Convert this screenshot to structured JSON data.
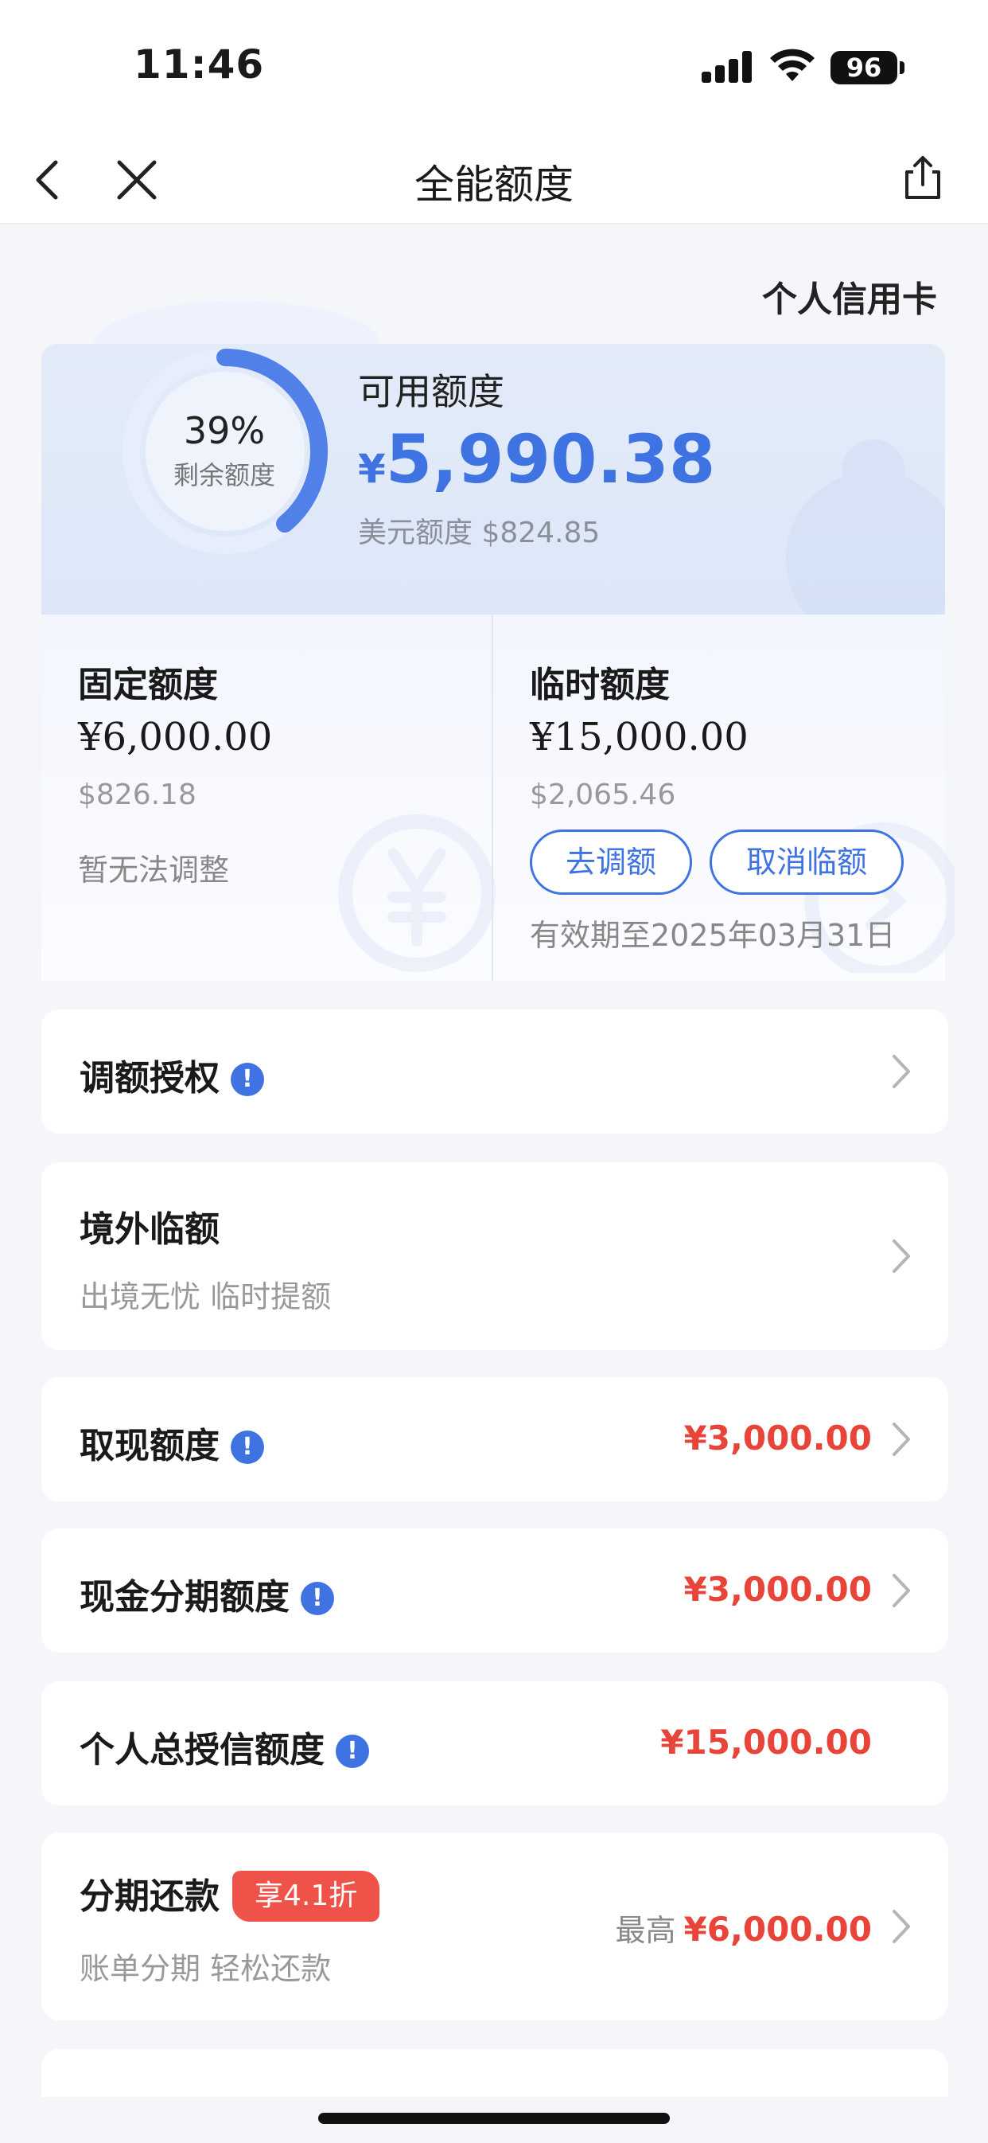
{
  "status_bar": {
    "time": "11:46",
    "battery": "96"
  },
  "nav": {
    "title": "全能额度"
  },
  "card_type": "个人信用卡",
  "available": {
    "ring_percent": "39%",
    "ring_fraction": 0.39,
    "ring_label": "剩余额度",
    "label": "可用额度",
    "currency_symbol": "¥",
    "amount": "5,990.38",
    "usd_text": "美元额度 $824.85"
  },
  "fixed": {
    "title": "固定额度",
    "amount": "¥6,000.00",
    "usd": "$826.18",
    "note": "暂无法调整"
  },
  "temp": {
    "title": "临时额度",
    "amount": "¥15,000.00",
    "usd": "$2,065.46",
    "adjust_label": "去调额",
    "cancel_label": "取消临额",
    "valid_until": "有效期至2025年03月31日"
  },
  "rows": {
    "auth": {
      "title": "调额授权"
    },
    "overseas": {
      "title": "境外临额",
      "subtitle": "出境无忧 临时提额"
    },
    "cash": {
      "title": "取现额度",
      "amount": "¥3,000.00"
    },
    "cash_installment": {
      "title": "现金分期额度",
      "amount": "¥3,000.00"
    },
    "total_credit": {
      "title": "个人总授信额度",
      "amount": "¥15,000.00"
    },
    "installment": {
      "title": "分期还款",
      "badge": "享4.1折",
      "subtitle": "账单分期 轻松还款",
      "prefix": "最高",
      "amount": "¥6,000.00"
    }
  },
  "colors": {
    "accent": "#3f73e2",
    "amount_red": "#e8443a",
    "page_bg": "#f4f6fa"
  }
}
